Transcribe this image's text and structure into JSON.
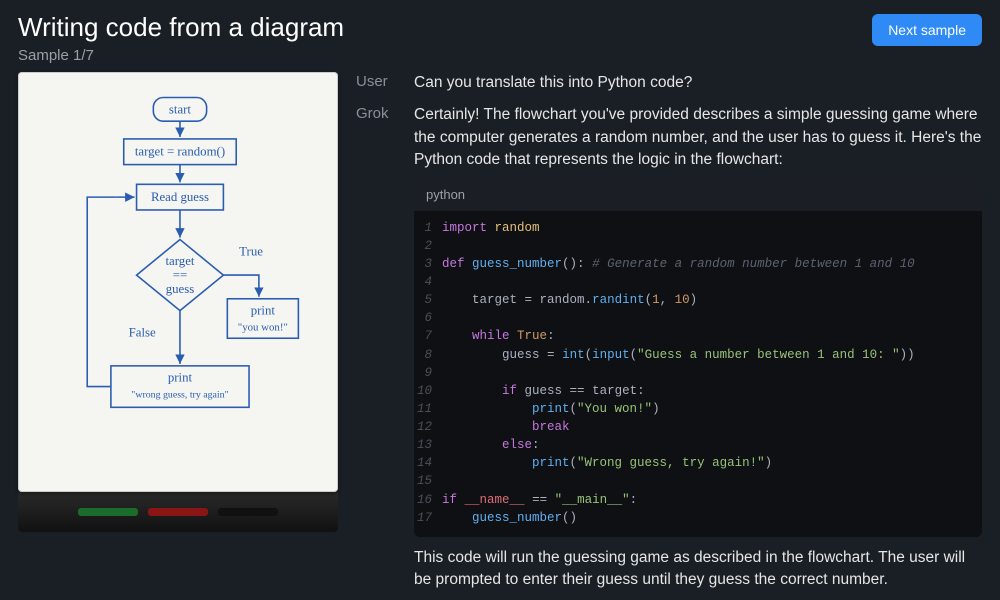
{
  "header": {
    "title": "Writing code from a diagram",
    "sample_counter": "Sample 1/7",
    "next_button": "Next sample"
  },
  "whiteboard": {
    "nodes": {
      "start": "start",
      "assign": "target = random()",
      "read": "Read guess",
      "cond_top": "target",
      "cond_mid": "==",
      "cond_bot": "guess",
      "true_label": "True",
      "false_label": "False",
      "win_top": "print",
      "win_bot": "\"you won!\"",
      "lose_top": "print",
      "lose_bot": "\"wrong guess, try again\""
    }
  },
  "chat": {
    "user_label": "User",
    "grok_label": "Grok",
    "user_msg": "Can you translate this into Python code?",
    "grok_intro": "Certainly! The flowchart you've provided describes a simple guessing game where the computer generates a random number, and the user has to guess it. Here's the Python code that represents the logic in the flowchart:",
    "grok_outro": "This code will run the guessing game as described in the flowchart. The user will be prompted to enter their guess until they guess the correct number.",
    "code": {
      "lang": "python",
      "lines": [
        [
          [
            "kw",
            "import"
          ],
          [
            "txt",
            " "
          ],
          [
            "mod",
            "random"
          ]
        ],
        [],
        [
          [
            "kw",
            "def"
          ],
          [
            "txt",
            " "
          ],
          [
            "def",
            "guess_number"
          ],
          [
            "txt",
            "(): "
          ],
          [
            "com",
            "# Generate a random number between 1 and 10"
          ]
        ],
        [],
        [
          [
            "txt",
            "    target "
          ],
          [
            "op",
            "="
          ],
          [
            "txt",
            " random"
          ],
          [
            "op",
            "."
          ],
          [
            "fn",
            "randint"
          ],
          [
            "txt",
            "("
          ],
          [
            "num",
            "1"
          ],
          [
            "txt",
            ", "
          ],
          [
            "num",
            "10"
          ],
          [
            "txt",
            ")"
          ]
        ],
        [],
        [
          [
            "txt",
            "    "
          ],
          [
            "kw",
            "while"
          ],
          [
            "txt",
            " "
          ],
          [
            "bool",
            "True"
          ],
          [
            "txt",
            ":"
          ]
        ],
        [
          [
            "txt",
            "        guess "
          ],
          [
            "op",
            "="
          ],
          [
            "txt",
            " "
          ],
          [
            "fn",
            "int"
          ],
          [
            "txt",
            "("
          ],
          [
            "fn",
            "input"
          ],
          [
            "txt",
            "("
          ],
          [
            "str",
            "\"Guess a number between 1 and 10: \""
          ],
          [
            "txt",
            "))"
          ]
        ],
        [],
        [
          [
            "txt",
            "        "
          ],
          [
            "kw",
            "if"
          ],
          [
            "txt",
            " guess "
          ],
          [
            "op",
            "=="
          ],
          [
            "txt",
            " target:"
          ]
        ],
        [
          [
            "txt",
            "            "
          ],
          [
            "fn",
            "print"
          ],
          [
            "txt",
            "("
          ],
          [
            "str",
            "\"You won!\""
          ],
          [
            "txt",
            ")"
          ]
        ],
        [
          [
            "txt",
            "            "
          ],
          [
            "kw",
            "break"
          ]
        ],
        [
          [
            "txt",
            "        "
          ],
          [
            "kw",
            "else"
          ],
          [
            "txt",
            ":"
          ]
        ],
        [
          [
            "txt",
            "            "
          ],
          [
            "fn",
            "print"
          ],
          [
            "txt",
            "("
          ],
          [
            "str",
            "\"Wrong guess, try again!\""
          ],
          [
            "txt",
            ")"
          ]
        ],
        [],
        [
          [
            "kw",
            "if"
          ],
          [
            "txt",
            " "
          ],
          [
            "dunder",
            "__name__"
          ],
          [
            "txt",
            " "
          ],
          [
            "op",
            "=="
          ],
          [
            "txt",
            " "
          ],
          [
            "str",
            "\"__main__\""
          ],
          [
            "txt",
            ":"
          ]
        ],
        [
          [
            "txt",
            "    "
          ],
          [
            "fn",
            "guess_number"
          ],
          [
            "txt",
            "()"
          ]
        ]
      ]
    }
  }
}
